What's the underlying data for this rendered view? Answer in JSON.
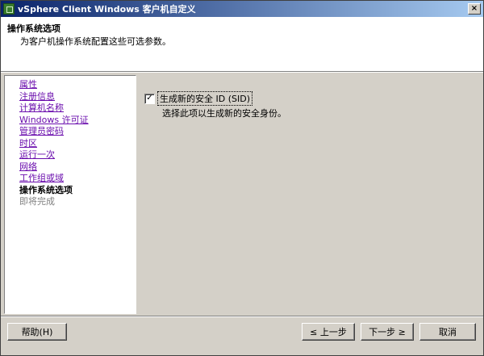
{
  "window": {
    "title": "vSphere Client Windows 客户机自定义",
    "close_glyph": "×"
  },
  "header": {
    "title": "操作系统选项",
    "description": "为客户机操作系统配置这些可选参数。"
  },
  "nav": {
    "items": [
      {
        "label": "属性",
        "state": "link"
      },
      {
        "label": "注册信息",
        "state": "link"
      },
      {
        "label": "计算机名称",
        "state": "link"
      },
      {
        "label": "Windows 许可证",
        "state": "link"
      },
      {
        "label": "管理员密码",
        "state": "link"
      },
      {
        "label": "时区",
        "state": "link"
      },
      {
        "label": "运行一次",
        "state": "link"
      },
      {
        "label": "网络",
        "state": "link"
      },
      {
        "label": "工作组或域",
        "state": "link"
      },
      {
        "label": "操作系统选项",
        "state": "current"
      },
      {
        "label": "即将完成",
        "state": "disabled"
      }
    ]
  },
  "content": {
    "checkbox_label": "生成新的安全 ID (SID)",
    "checkbox_checked": true,
    "checkbox_mark": "✓",
    "checkbox_description": "选择此项以生成新的安全身份。"
  },
  "footer": {
    "help_label": "帮助(H)",
    "back_label": "≤ 上一步",
    "next_label": "下一步 ≥",
    "cancel_label": "取消"
  },
  "colors": {
    "titlebar_start": "#0a246a",
    "titlebar_end": "#a6caf0",
    "link": "#6a0dad",
    "face": "#d4d0c8"
  }
}
